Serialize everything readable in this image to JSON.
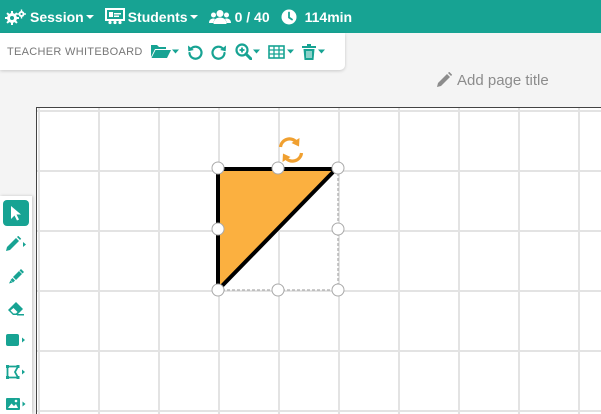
{
  "topbar": {
    "session_label": "Session",
    "students_label": "Students",
    "students_count": "0 / 40",
    "time_remaining": "114min"
  },
  "toolbar": {
    "title": "TEACHER WHITEBOARD"
  },
  "page": {
    "title_placeholder": "Add page title"
  },
  "colors": {
    "brand_teal": "#17a393",
    "shape_fill": "#fbb040",
    "rotate_handle": "#f0a030",
    "grid_line": "#e3e3e3"
  },
  "icons": {
    "session": "gears-icon",
    "students": "presentation-board-icon",
    "users": "users-icon",
    "clock": "clock-icon",
    "open": "folder-open-icon",
    "undo": "undo-icon",
    "redo": "redo-icon",
    "zoom": "zoom-in-icon",
    "grid": "grid-icon",
    "delete": "trash-icon",
    "edit_title": "pencil-icon",
    "rotate": "rotate-icon"
  },
  "tools": [
    "select",
    "pen",
    "highlighter",
    "eraser",
    "shape",
    "polygon",
    "image"
  ]
}
